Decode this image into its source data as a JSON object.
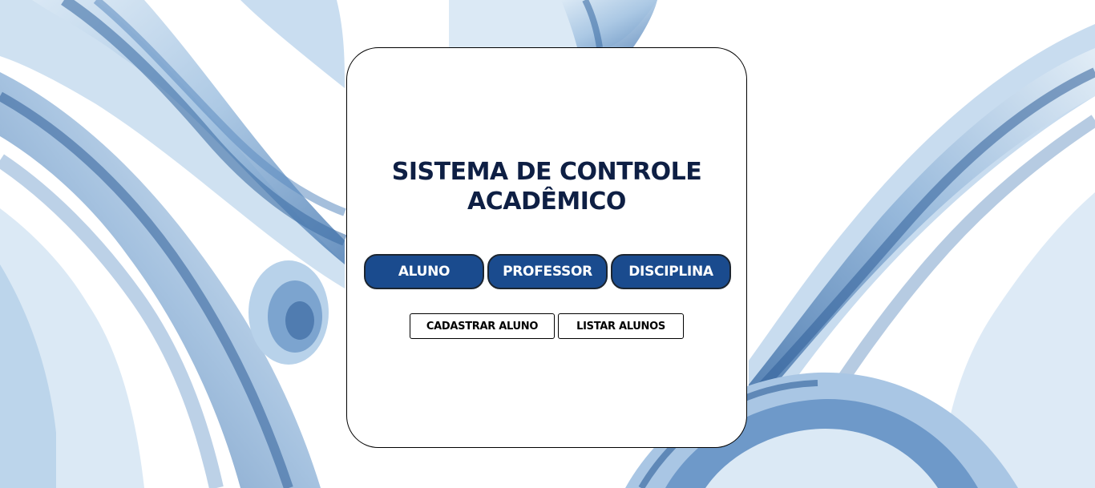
{
  "title_line1": "SISTEMA DE CONTROLE",
  "title_line2": "ACADÊMICO",
  "nav": [
    {
      "label": "ALUNO"
    },
    {
      "label": "PROFESSOR"
    },
    {
      "label": "DISCIPLINA"
    }
  ],
  "actions": {
    "cadastrar_label": "CADASTRAR ALUNO",
    "listar_label": "LISTAR ALUNOS"
  },
  "colors": {
    "title": "#0e1f44",
    "nav_button_bg": "#1a4b8e",
    "nav_button_text": "#ffffff",
    "panel_bg": "#ffffff",
    "background_accent": "#4f7fb5"
  }
}
